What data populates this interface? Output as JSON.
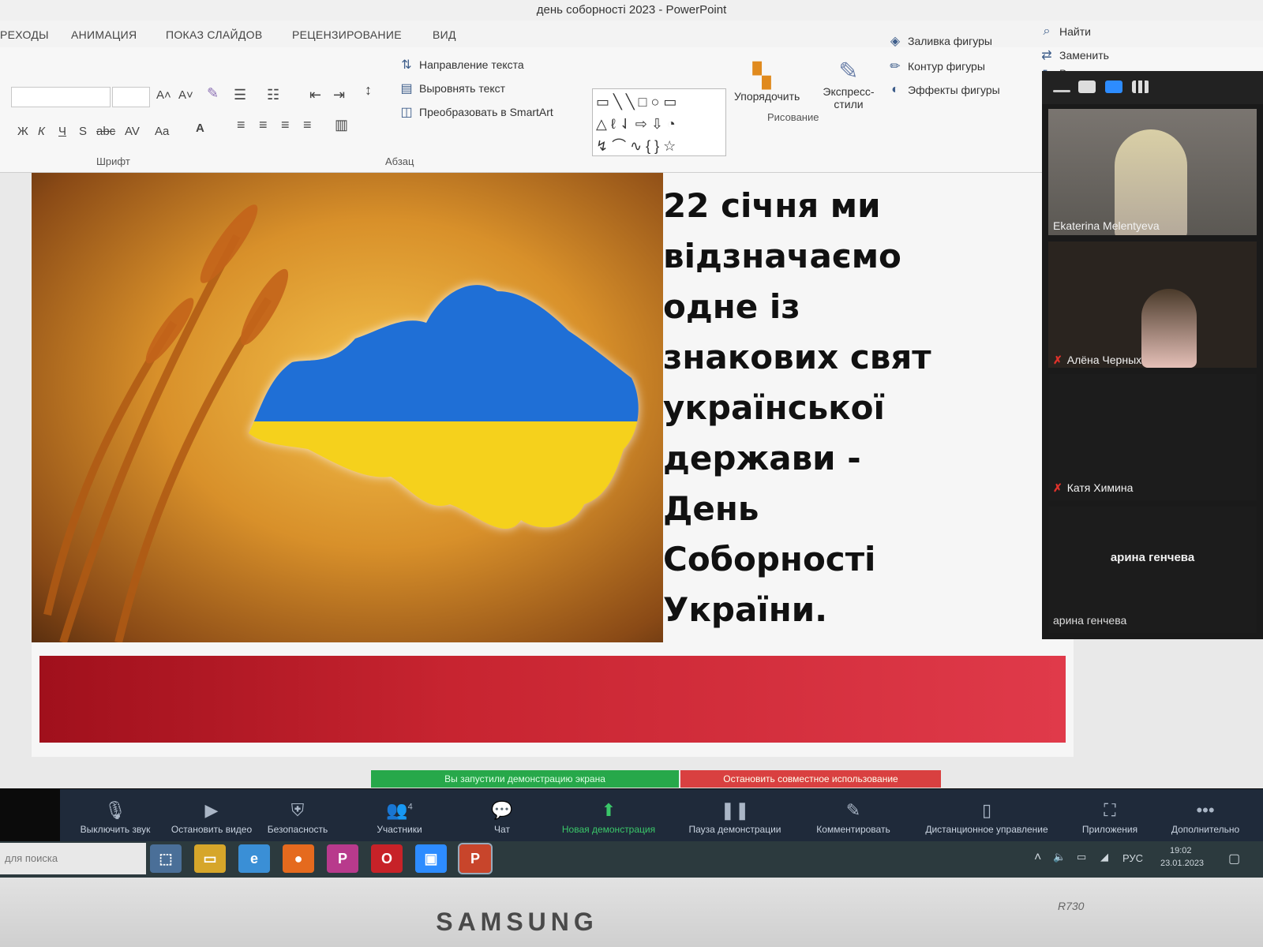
{
  "window": {
    "title": "день соборності 2023 - PowerPoint"
  },
  "ribbon": {
    "tabs": [
      "РЕХОДЫ",
      "АНИМАЦИЯ",
      "ПОКАЗ СЛАЙДОВ",
      "РЕЦЕНЗИРОВАНИЕ",
      "ВИД"
    ],
    "font_group": {
      "label": "Шрифт",
      "font_name": "",
      "font_size": "",
      "format_buttons": [
        "Ж",
        "К",
        "Ч",
        "S",
        "abc",
        "AV",
        "Aa",
        "A"
      ],
      "grow_label": "A˄",
      "shrink_label": "A˅"
    },
    "paragraph_group": {
      "label": "Абзац",
      "text_direction": "Направление текста",
      "align_text": "Выровнять текст",
      "smartart": "Преобразовать в SmartArt"
    },
    "drawing_group": {
      "label": "Рисование",
      "arrange": "Упорядочить",
      "quick_styles_line1": "Экспресс-",
      "quick_styles_line2": "стили",
      "shape_fill": "Заливка фигуры",
      "shape_outline": "Контур фигуры",
      "shape_effects": "Эффекты фигуры"
    },
    "editing_group": {
      "find": "Найти",
      "replace": "Заменить",
      "select": "Выделить"
    }
  },
  "slide": {
    "text_lines": [
      "22 січня ми",
      "відзначаємо",
      "одне із",
      "знакових свят",
      "української",
      "держави -",
      "День",
      "Соборності",
      "України."
    ],
    "colors": {
      "band": "#c72430",
      "flag_blue": "#1f6fd6",
      "flag_yellow": "#f5d11c"
    }
  },
  "zoom": {
    "participants": [
      {
        "name": "Ekaterina Melentyeva",
        "muted": false
      },
      {
        "name": "Алёна Черных",
        "muted": true
      },
      {
        "name": "Катя Химина",
        "muted": true
      },
      {
        "name": "арина генчева",
        "muted": false
      }
    ],
    "tile_caption": "арина генчева",
    "share_notice": "Вы запустили демонстрацию экрана",
    "stop_share": "Остановить совместное использование",
    "controls": [
      {
        "label": "Выключить звук",
        "icon": "microphone-icon"
      },
      {
        "label": "Остановить видео",
        "icon": "video-camera-icon"
      },
      {
        "label": "Безопасность",
        "icon": "shield-icon"
      },
      {
        "label": "Участники",
        "icon": "participants-icon",
        "count": "4"
      },
      {
        "label": "Чат",
        "icon": "chat-icon"
      },
      {
        "label": "Новая демонстрация",
        "icon": "share-screen-icon"
      },
      {
        "label": "Пауза демонстрации",
        "icon": "pause-icon"
      },
      {
        "label": "Комментировать",
        "icon": "pen-icon"
      },
      {
        "label": "Дистанционное управление",
        "icon": "remote-control-icon"
      },
      {
        "label": "Приложения",
        "icon": "apps-icon"
      },
      {
        "label": "Дополнительно",
        "icon": "more-icon"
      }
    ]
  },
  "taskbar": {
    "search_placeholder": "для поиска",
    "apps": [
      "app-icon",
      "file-explorer-icon",
      "edge-icon",
      "firefox-icon",
      "p-icon",
      "opera-icon",
      "zoom-icon",
      "powerpoint-icon"
    ],
    "tray": {
      "language": "РУС",
      "time": "19:02",
      "date": "23.01.2023"
    }
  },
  "monitor": {
    "brand": "SAMSUNG",
    "model": "R730"
  }
}
